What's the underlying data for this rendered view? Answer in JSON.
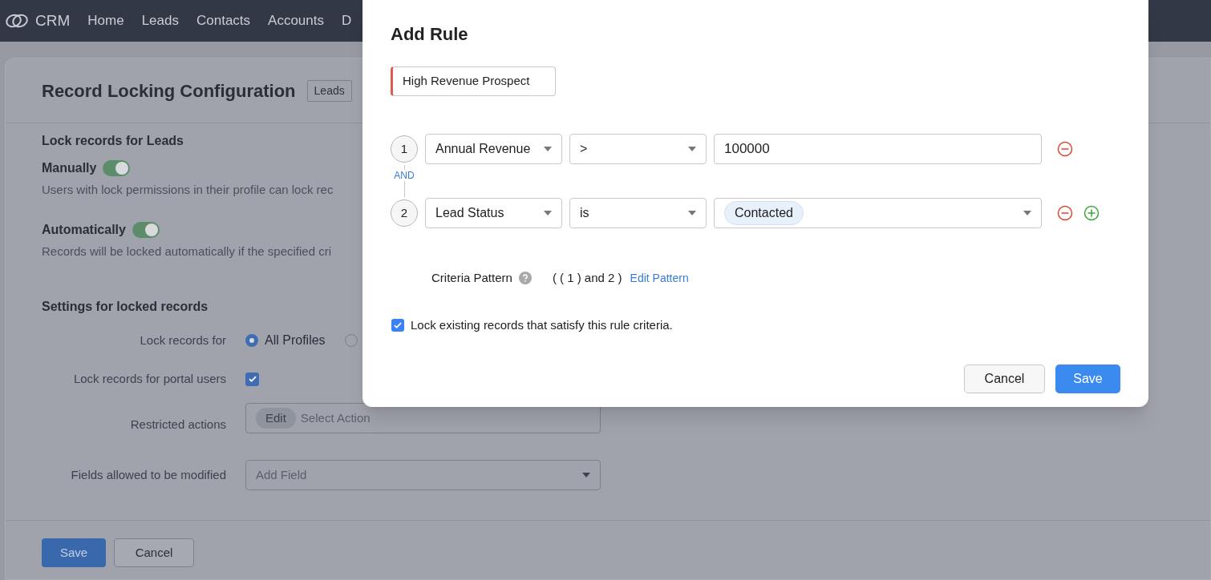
{
  "top_nav": {
    "logo": "CRM",
    "items": [
      {
        "label": "Home"
      },
      {
        "label": "Leads"
      },
      {
        "label": "Contacts"
      },
      {
        "label": "Accounts"
      },
      {
        "label": "D"
      }
    ]
  },
  "page": {
    "title": "Record Locking Configuration",
    "module_badge": "Leads",
    "section_title": "Lock records for Leads",
    "lock_modes": [
      {
        "label": "Manually",
        "on": true,
        "description": "Users with lock permissions in their profile can lock rec"
      },
      {
        "label": "Automatically",
        "on": true,
        "description": "Records will be locked automatically if the specified cri"
      }
    ],
    "settings_title": "Settings for locked records",
    "settings": [
      {
        "kind": "radio",
        "label": "Lock records for",
        "options": [
          {
            "label": "All Profiles",
            "selected": true
          },
          {
            "selected": false
          }
        ]
      },
      {
        "kind": "checkbox",
        "label": "Lock records for portal users",
        "checked": true
      },
      {
        "kind": "chips",
        "label": "Restricted actions",
        "chips": [
          "Edit"
        ],
        "placeholder": "Select Action"
      },
      {
        "kind": "dropdown",
        "label": "Fields allowed to be modified",
        "placeholder": "Add Field"
      }
    ],
    "buttons": [
      {
        "label": "Save",
        "primary": true
      },
      {
        "label": "Cancel",
        "primary": false
      }
    ]
  },
  "dialog": {
    "title": "Add Rule",
    "rule_name": "High Revenue Prospect",
    "criteria": [
      {
        "number": "1",
        "field": "Annual Revenue",
        "operator": ">",
        "kind": "text",
        "value": "100000",
        "can_add": false
      },
      {
        "number": "2",
        "field": "Lead Status",
        "operator": "is",
        "kind": "picklist",
        "value": "Contacted",
        "can_add": true
      }
    ],
    "connector": "AND",
    "pattern_label": "Criteria Pattern",
    "pattern": "( ( 1 ) and 2 )",
    "edit_pattern": "Edit Pattern",
    "lock_existing": {
      "label": "Lock existing records that satisfy this rule criteria.",
      "checked": true
    },
    "buttons": [
      {
        "label": "Cancel",
        "primary": false
      },
      {
        "label": "Save",
        "primary": true
      }
    ]
  }
}
